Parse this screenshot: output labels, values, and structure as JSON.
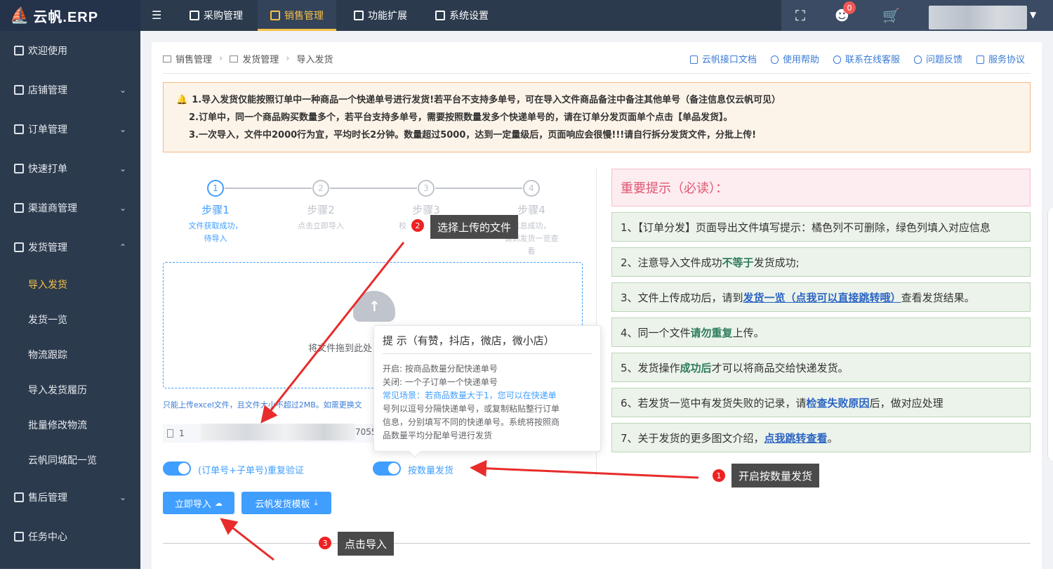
{
  "brand": {
    "name": "云帆.ERP"
  },
  "topnav": {
    "tabs": [
      {
        "label": "采购管理"
      },
      {
        "label": "销售管理"
      },
      {
        "label": "功能扩展"
      },
      {
        "label": "系统设置"
      }
    ],
    "cart_badge": "0",
    "accent": "#f5c148"
  },
  "sidebar": {
    "items": [
      {
        "label": "欢迎使用"
      },
      {
        "label": "店铺管理"
      },
      {
        "label": "订单管理"
      },
      {
        "label": "快速打单"
      },
      {
        "label": "渠道商管理"
      },
      {
        "label": "发货管理"
      },
      {
        "label": "售后管理"
      },
      {
        "label": "任务中心"
      }
    ],
    "sub_items": [
      {
        "label": "导入发货"
      },
      {
        "label": "发货一览"
      },
      {
        "label": "物流跟踪"
      },
      {
        "label": "导入发货履历"
      },
      {
        "label": "批量修改物流"
      },
      {
        "label": "云帆同城配一览"
      }
    ]
  },
  "breadcrumb": [
    "销售管理",
    "发货管理",
    "导入发货"
  ],
  "header_links": [
    "云帆接口文档",
    "使用帮助",
    "联系在线客服",
    "问题反馈",
    "服务协议"
  ],
  "warning": {
    "line1": "1.导入发货仅能按照订单中一种商品一个快递单号进行发货!若平台不支持多单号，可在导入文件商品备注中备注其他单号（备注信息仅云帆可见）",
    "line2": "2.订单中，同一个商品购买数量多个，若平台支持多单号，需要按照数量发多个快递单号的，请在订单分发页面单个点击【单品发货】。",
    "line3": "3.一次导入，文件中2000行为宜，平均时长2分钟。数量超过5000，达到一定量级后，页面响应会很慢!!!请自行拆分发货文件，分批上传!"
  },
  "steps": [
    {
      "num": "1",
      "title": "步骤1",
      "desc1": "文件获取成功，",
      "desc2": "待导入",
      "desc3": ""
    },
    {
      "num": "2",
      "title": "步骤2",
      "desc1": "点击立即导入",
      "desc2": "",
      "desc3": ""
    },
    {
      "num": "3",
      "title": "步骤3",
      "desc1": "校",
      "desc2": "",
      "desc3": ""
    },
    {
      "num": "4",
      "title": "步骤4",
      "desc1": "信息成功，",
      "desc2": "请到发货一览查",
      "desc3": "看"
    }
  ],
  "upload": {
    "text": "将文件拖到此处",
    "tip": "只能上传excel文件，且文件大小不超过2MB。如需更换文",
    "file_prefix": "1",
    "file_suffix": "70551_"
  },
  "switches": {
    "dup_check": "(订单号+子单号)重复验证",
    "by_quantity": "按数量发货"
  },
  "buttons": {
    "import": "立即导入",
    "template": "云帆发货模板"
  },
  "notes": {
    "title": "重要提示（必读）：",
    "n1": "1、【订单分发】页面导出文件填写提示：橘色列不可删除，绿色列填入对应信息",
    "n2a": "2、注意导入文件成功",
    "n2b": "不等于",
    "n2c": "发货成功;",
    "n3a": "3、文件上传成功后，请到",
    "n3b": "发货一览（点我可以直接跳转哦）",
    "n3c": "查看发货结果。",
    "n4a": "4、同一个文件",
    "n4b": "请勿重复",
    "n4c": "上传。",
    "n5a": "5、发货操作",
    "n5b": "成功后",
    "n5c": "才可以将商品交给快递发货。",
    "n6a": "6、若发货一览中有发货失败的记录，请 ",
    "n6b": "检查失败原因",
    "n6c": " 后，做对应处理",
    "n7a": "7、关于发货的更多图文介绍，",
    "n7b": "点我跳转查看",
    "n7c": "。"
  },
  "popover": {
    "title": "提 示（有赞，抖店，微店，微小店）",
    "on": "开启: 按商品数量分配快递单号",
    "off": "关闭: 一个子订单一个快递单号",
    "scene1": "常见场景：若商品数量大于1，您可以在快递单",
    "scene2": "号列以逗号分隔快递单号，或复制粘贴整行订单",
    "desc1": "信息，分别填写不同的快递单号。系统将按照商",
    "desc2": "品数量平均分配单号进行发货"
  },
  "annotations": [
    {
      "num": "1",
      "text": "开启按数量发货"
    },
    {
      "num": "2",
      "text": "选择上传的文件"
    },
    {
      "num": "3",
      "text": "点击导入"
    }
  ]
}
